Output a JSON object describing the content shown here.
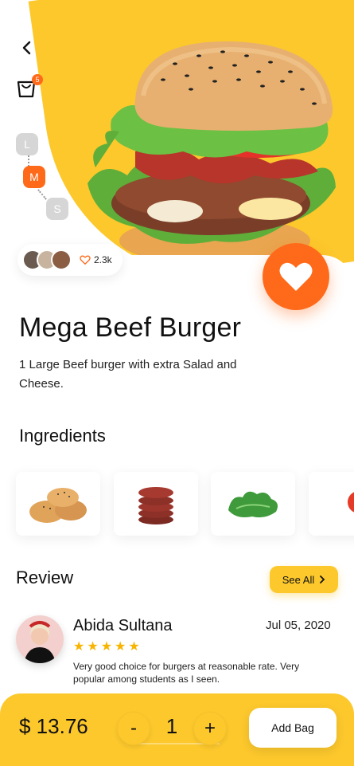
{
  "colors": {
    "accent_yellow": "#fcc82c",
    "accent_orange": "#ff6a1a",
    "star": "#f7b500"
  },
  "header": {
    "back_icon": "chevron-left-icon",
    "cart_icon": "shopping-bag-icon",
    "cart_badge": "5"
  },
  "sizes": [
    {
      "label": "L",
      "selected": false
    },
    {
      "label": "M",
      "selected": true
    },
    {
      "label": "S",
      "selected": false
    }
  ],
  "social": {
    "like_count": "2.3k",
    "like_icon": "heart-outline-icon"
  },
  "favorite_icon": "heart-filled-icon",
  "product": {
    "name": "Mega Beef Burger",
    "description": "1 Large Beef burger with extra Salad and Cheese."
  },
  "ingredients": {
    "title": "Ingredients",
    "items": [
      "bun",
      "beef-patties",
      "lettuce",
      "tomato"
    ]
  },
  "review": {
    "title": "Review",
    "see_all": "See All",
    "reviewer": {
      "name": "Abida Sultana",
      "date": "Jul 05, 2020",
      "rating": 5,
      "text": "Very good choice for burgers at reasonable rate. Very popular among students as I seen."
    }
  },
  "footer": {
    "price": "$ 13.76",
    "minus": "-",
    "quantity": "1",
    "plus": "+",
    "add_bag": "Add Bag"
  }
}
